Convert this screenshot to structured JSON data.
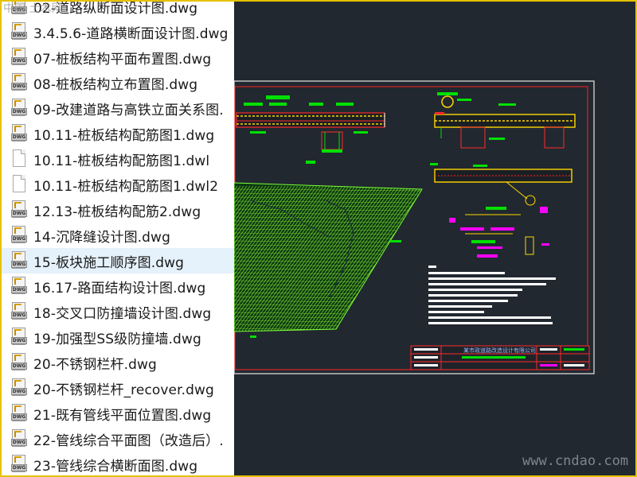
{
  "watermark_top": "中国 土木网",
  "site_watermark": "www.cndao.com",
  "title_block_text": "某市政道路改造设计有限公司",
  "files": [
    {
      "name": "02-道路纵断面设计图.dwg",
      "icon": "dwg-file-icon",
      "selected": false
    },
    {
      "name": "3.4.5.6-道路横断面设计图.dwg",
      "icon": "dwg-file-icon",
      "selected": false
    },
    {
      "name": "07-桩板结构平面布置图.dwg",
      "icon": "dwg-file-icon",
      "selected": false
    },
    {
      "name": "08-桩板结构立布置图.dwg",
      "icon": "dwg-file-icon",
      "selected": false
    },
    {
      "name": "09-改建道路与高铁立面关系图.",
      "icon": "dwg-file-icon",
      "selected": false
    },
    {
      "name": "10.11-桩板结构配筋图1.dwg",
      "icon": "dwg-file-icon",
      "selected": false
    },
    {
      "name": "10.11-桩板结构配筋图1.dwl",
      "icon": "blank-file-icon",
      "selected": false
    },
    {
      "name": "10.11-桩板结构配筋图1.dwl2",
      "icon": "blank-file-icon",
      "selected": false
    },
    {
      "name": "12.13-桩板结构配筋2.dwg",
      "icon": "dwg-file-icon",
      "selected": false
    },
    {
      "name": "14-沉降缝设计图.dwg",
      "icon": "dwg-file-icon",
      "selected": false
    },
    {
      "name": "15-板块施工顺序图.dwg",
      "icon": "dwg-file-icon",
      "selected": true
    },
    {
      "name": "16.17-路面结构设计图.dwg",
      "icon": "dwg-file-icon",
      "selected": false
    },
    {
      "name": "18-交叉口防撞墙设计图.dwg",
      "icon": "dwg-file-icon",
      "selected": false
    },
    {
      "name": "19-加强型SS级防撞墙.dwg",
      "icon": "dwg-file-icon",
      "selected": false
    },
    {
      "name": "20-不锈钢栏杆.dwg",
      "icon": "dwg-file-icon",
      "selected": false
    },
    {
      "name": "20-不锈钢栏杆_recover.dwg",
      "icon": "dwg-file-icon",
      "selected": false
    },
    {
      "name": "21-既有管线平面位置图.dwg",
      "icon": "dwg-file-icon",
      "selected": false
    },
    {
      "name": "22-管线综合平面图（改造后）.",
      "icon": "dwg-file-icon",
      "selected": false
    },
    {
      "name": "23-管线综合横断面图.dwg",
      "icon": "dwg-file-icon",
      "selected": false
    }
  ],
  "colors": {
    "cad_background": "#212830",
    "selection": "#e5f1fb",
    "frame": "#e6c200",
    "rebar_red": "#ff2a2a",
    "rebar_yellow": "#ffd800",
    "line_green": "#00e000",
    "magenta": "#ff00ff"
  }
}
